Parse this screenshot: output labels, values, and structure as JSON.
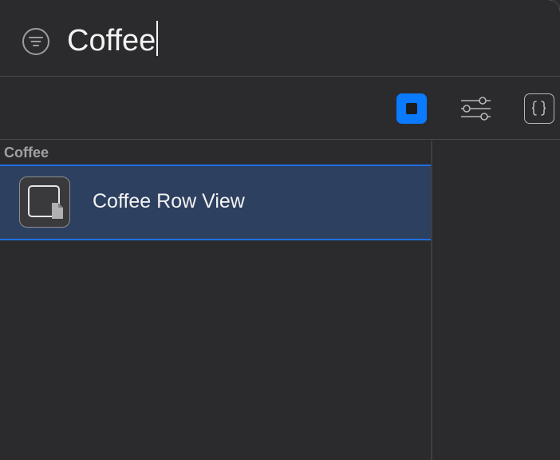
{
  "search": {
    "query": "Coffee",
    "filter_icon": "filter-icon"
  },
  "toolbar": {
    "buttons": [
      {
        "name": "views",
        "icon": "square-stop-icon",
        "selected": true
      },
      {
        "name": "modifiers",
        "icon": "sliders-icon",
        "selected": false
      },
      {
        "name": "snippets",
        "icon": "braces-icon",
        "selected": false
      }
    ]
  },
  "list": {
    "section_title": "Coffee",
    "items": [
      {
        "label": "Coffee Row View",
        "icon": "swift-view-file-icon",
        "selected": true
      }
    ]
  },
  "colors": {
    "accent": "#0a7aff",
    "selection_bg": "#2e4060",
    "background": "#2b2b2d"
  }
}
